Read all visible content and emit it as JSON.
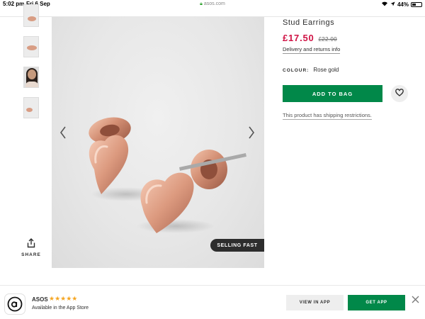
{
  "status_bar": {
    "time": "5:02 pm",
    "date": "Fri 6 Sep",
    "url": "asos.com",
    "battery": "44%",
    "battery_level": 0.44
  },
  "thumbnails": [
    {
      "name": "thumb-1",
      "kind": "earring"
    },
    {
      "name": "thumb-2",
      "kind": "earring"
    },
    {
      "name": "thumb-3",
      "kind": "model"
    },
    {
      "name": "thumb-4",
      "kind": "earring"
    }
  ],
  "share": {
    "label": "SHARE",
    "icon": "share-icon"
  },
  "gallery": {
    "badge": "SELLING FAST",
    "prev_icon": "chevron-left-icon",
    "next_icon": "chevron-right-icon"
  },
  "product": {
    "title": "Stud Earrings",
    "price_now": "£17.50",
    "price_was": "£22.00",
    "delivery_link": "Delivery and returns info",
    "colour_label": "COLOUR:",
    "colour_value": "Rose gold",
    "add_to_bag": "ADD TO BAG",
    "save_icon": "heart-icon",
    "shipping_link": "This product has shipping restrictions."
  },
  "app_banner": {
    "name": "ASOS",
    "rating_stars": "★★★★★",
    "rating": 5,
    "subtitle": "Available in the App Store",
    "view_in_app": "VIEW IN APP",
    "get_app": "GET APP",
    "close_icon": "close-icon"
  },
  "colors": {
    "accent_green": "#018849",
    "sale_red": "#d01345",
    "star_gold": "#f5a623"
  }
}
